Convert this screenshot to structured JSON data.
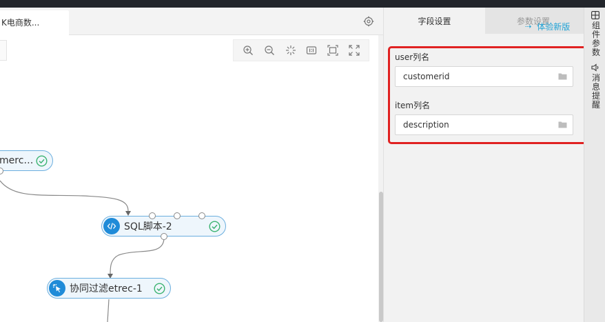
{
  "window": {
    "tab_title": "K电商数..."
  },
  "canvas": {
    "toolbar": [
      {
        "name": "zoom-in-icon"
      },
      {
        "name": "zoom-out-icon"
      },
      {
        "name": "fit-center-icon"
      },
      {
        "name": "actual-size-icon"
      },
      {
        "name": "fit-screen-icon"
      },
      {
        "name": "fullscreen-icon"
      }
    ],
    "nodes": {
      "node1": {
        "label": "merc…",
        "status": "success"
      },
      "node2": {
        "label": "SQL脚本-2",
        "status": "success"
      },
      "node3": {
        "label": "协同过滤etrec-1",
        "status": "success"
      }
    }
  },
  "panel": {
    "tabs": {
      "field_settings": "字段设置",
      "param_settings": "参数设置"
    },
    "new_version": "体验新版",
    "fields": {
      "user_label": "user列名",
      "user_value": "customerid",
      "item_label": "item列名",
      "item_value": "description"
    }
  },
  "strip": {
    "component_params": "组件参数",
    "message_reminder": "消息提醒"
  },
  "colors": {
    "accent": "#1f8bd8",
    "link": "#20a3d6",
    "highlight": "#e02121",
    "success": "#3cb371"
  }
}
